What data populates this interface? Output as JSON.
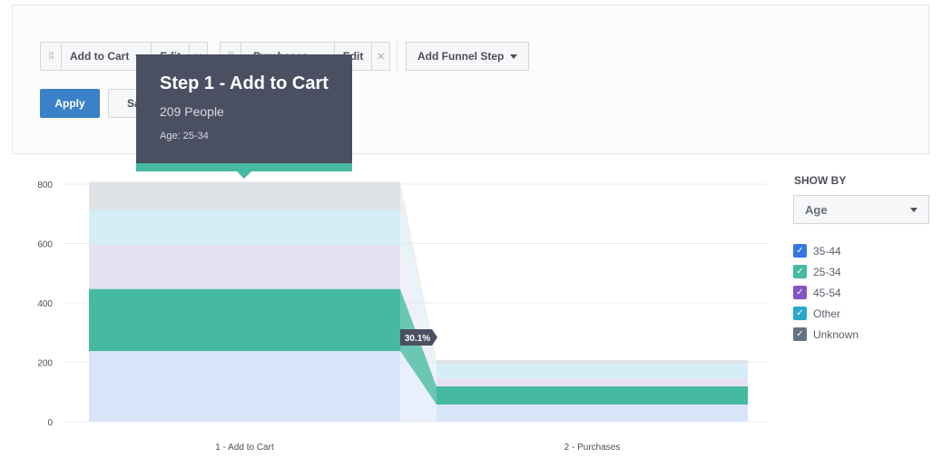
{
  "toolbar": {
    "steps": [
      {
        "label": "Add to Cart",
        "edit": "Edit",
        "remove": "×"
      },
      {
        "label": "Purchases",
        "edit": "Edit",
        "remove": "×"
      }
    ],
    "add_step": "Add Funnel Step",
    "apply": "Apply",
    "save": "Save"
  },
  "tooltip": {
    "title": "Step 1 - Add to Cart",
    "count": "209 People",
    "detail": "Age: 25-34",
    "color": "#46b9a1"
  },
  "sidebar": {
    "show_by_label": "SHOW BY",
    "show_by_value": "Age",
    "legend": [
      {
        "label": "35-44",
        "color": "#3578e5",
        "checked": true
      },
      {
        "label": "25-34",
        "color": "#46b9a1",
        "checked": true
      },
      {
        "label": "45-54",
        "color": "#7e57c2",
        "checked": true
      },
      {
        "label": "Other",
        "color": "#2aa8c9",
        "checked": true
      },
      {
        "label": "Unknown",
        "color": "#637381",
        "checked": true
      }
    ]
  },
  "chart_data": {
    "type": "bar",
    "stacked": true,
    "categories": [
      "1 - Add to Cart",
      "2 - Purchases"
    ],
    "series": [
      {
        "name": "35-44",
        "values": [
          238,
          58
        ],
        "color": "#d8e4f8"
      },
      {
        "name": "25-34",
        "values": [
          209,
          61
        ],
        "color": "#46b9a1"
      },
      {
        "name": "45-54",
        "values": [
          147,
          27
        ],
        "color": "#e6e1f2"
      },
      {
        "name": "Other",
        "values": [
          119,
          49
        ],
        "color": "#d4edf6"
      },
      {
        "name": "Unknown",
        "values": [
          95,
          12
        ],
        "color": "#dfe3e8"
      }
    ],
    "yticks": [
      "0",
      "200",
      "400",
      "600",
      "800"
    ],
    "ylim": [
      0,
      800
    ],
    "conversion_label": "30.1%",
    "grid": true
  }
}
